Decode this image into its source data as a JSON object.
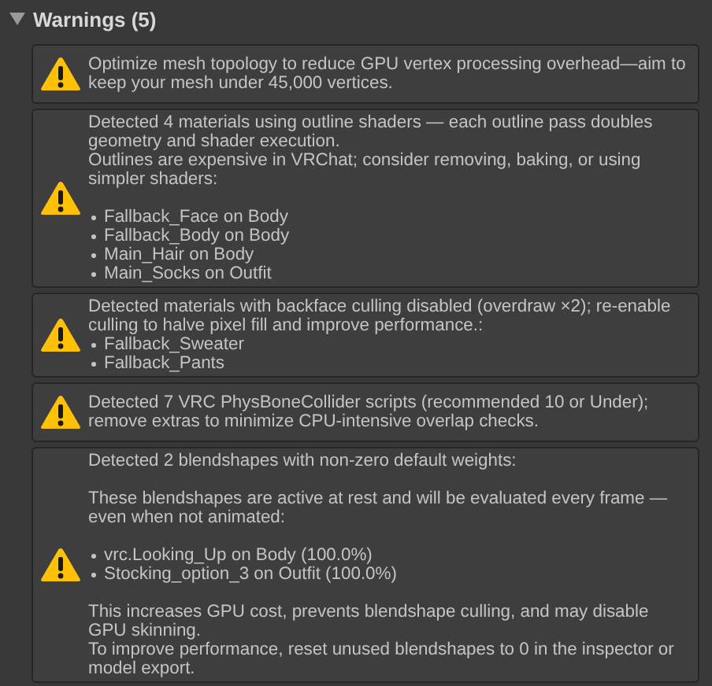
{
  "section": {
    "title": "Warnings (5)",
    "expanded": true
  },
  "warnings": [
    {
      "blocks": [
        {
          "kind": "text",
          "text": "Optimize mesh topology to reduce GPU vertex processing overhead—aim to keep your mesh under 45,000 vertices."
        }
      ]
    },
    {
      "blocks": [
        {
          "kind": "text",
          "text": "Detected 4 materials using outline shaders — each outline pass doubles geometry and shader execution."
        },
        {
          "kind": "text",
          "text": "Outlines are expensive in VRChat; consider removing, baking, or using simpler shaders:"
        },
        {
          "kind": "gap"
        },
        {
          "kind": "bullet",
          "text": "Fallback_Face on Body"
        },
        {
          "kind": "bullet",
          "text": "Fallback_Body on Body"
        },
        {
          "kind": "bullet",
          "text": "Main_Hair on Body"
        },
        {
          "kind": "bullet",
          "text": "Main_Socks on Outfit"
        }
      ]
    },
    {
      "blocks": [
        {
          "kind": "text",
          "text": "Detected materials with backface culling disabled (overdraw ×2); re-enable culling to halve pixel fill and improve performance.:"
        },
        {
          "kind": "bullet",
          "text": "Fallback_Sweater"
        },
        {
          "kind": "bullet",
          "text": "Fallback_Pants"
        }
      ]
    },
    {
      "blocks": [
        {
          "kind": "text",
          "text": "Detected 7 VRC PhysBoneCollider scripts (recommended 10 or Under); remove extras to minimize CPU-intensive overlap checks."
        }
      ]
    },
    {
      "blocks": [
        {
          "kind": "text",
          "text": "Detected 2 blendshapes with non-zero default weights:"
        },
        {
          "kind": "gap"
        },
        {
          "kind": "text",
          "text": "These blendshapes are active at rest and will be evaluated every frame — even when not animated:"
        },
        {
          "kind": "gap"
        },
        {
          "kind": "bullet",
          "text": "vrc.Looking_Up on Body (100.0%)"
        },
        {
          "kind": "bullet",
          "text": "Stocking_option_3 on Outfit (100.0%)"
        },
        {
          "kind": "gap"
        },
        {
          "kind": "text",
          "text": "This increases GPU cost, prevents blendshape culling, and may disable GPU skinning."
        },
        {
          "kind": "text",
          "text": "To improve performance, reset unused blendshapes to 0 in the inspector or model export."
        }
      ]
    }
  ]
}
